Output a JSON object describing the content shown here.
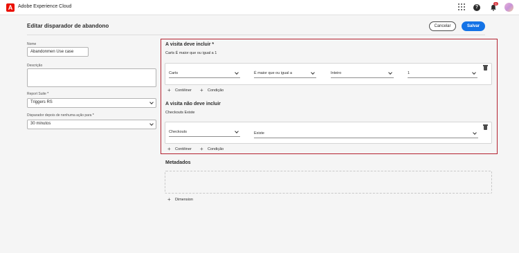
{
  "app": {
    "title": "Adobe Experience Cloud",
    "logo_letter": "A",
    "notification_count": "5"
  },
  "header": {
    "title": "Editar disparador de abandono",
    "cancel_label": "Cancelar",
    "save_label": "Salvar"
  },
  "form": {
    "name_label": "Nome",
    "name_value": "Abandonmen Use case",
    "description_label": "Descrição",
    "description_value": "",
    "report_suite_label": "Report Suite",
    "report_suite_value": "Triggers RS",
    "trigger_after_label": "Disparador depois de nenhuma ação para",
    "trigger_after_value": "30 minutos",
    "required_mark": "*"
  },
  "must_include": {
    "title": "A visita deve incluir *",
    "summary": "Carts É maior que ou igual a 1",
    "rule": {
      "dimension": "Carts",
      "operator": "É maior que ou igual a",
      "type": "Inteiro",
      "value": "1"
    },
    "add_container": "Contêiner",
    "add_condition": "Condição"
  },
  "must_not_include": {
    "title": "A visita não deve incluir",
    "summary": "Checkouts Existe",
    "rule": {
      "dimension": "Checkouts",
      "operator": "Existe"
    },
    "add_container": "Contêiner",
    "add_condition": "Condição"
  },
  "metadata": {
    "title": "Metadados",
    "add_dimension": "Dimension"
  },
  "icons": {
    "plus": "+",
    "help": "?"
  },
  "colors": {
    "accent": "#1473e6",
    "brand": "#eb1000",
    "highlight_border": "#b3202f"
  }
}
